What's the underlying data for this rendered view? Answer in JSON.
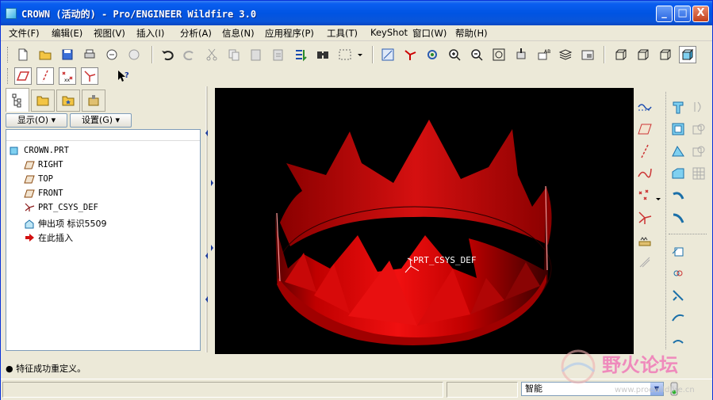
{
  "window": {
    "title": "CROWN (活动的) - Pro/ENGINEER Wildfire 3.0",
    "minimize_label": "_",
    "maximize_label": "□",
    "close_label": "X"
  },
  "menu": [
    "文件(F)",
    "编辑(E)",
    "视图(V)",
    "插入(I)",
    "分析(A)",
    "信息(N)",
    "应用程序(P)",
    "工具(T)",
    "KeyShot",
    "窗口(W)",
    "帮助(H)"
  ],
  "model_tree": {
    "display_button": "显示(O) ▾",
    "settings_button": "设置(G) ▾",
    "items": [
      {
        "label": "CROWN.PRT",
        "icon": "part-icon"
      },
      {
        "label": "RIGHT",
        "icon": "datum-plane-icon"
      },
      {
        "label": "TOP",
        "icon": "datum-plane-icon"
      },
      {
        "label": "FRONT",
        "icon": "datum-plane-icon"
      },
      {
        "label": "PRT_CSYS_DEF",
        "icon": "csys-icon"
      },
      {
        "label": "伸出项 标识5509",
        "icon": "protrusion-icon"
      },
      {
        "label": "在此插入",
        "icon": "insert-here-arrow-icon"
      }
    ]
  },
  "viewport": {
    "csys_label": "PRT_CSYS_DEF",
    "background": "#000000",
    "model_color": "#e00000"
  },
  "status": {
    "message": "● 特征成功重定义。",
    "filter_value": "智能"
  },
  "watermark": {
    "text": "野火论坛",
    "url": "www.proewildfire.cn"
  }
}
